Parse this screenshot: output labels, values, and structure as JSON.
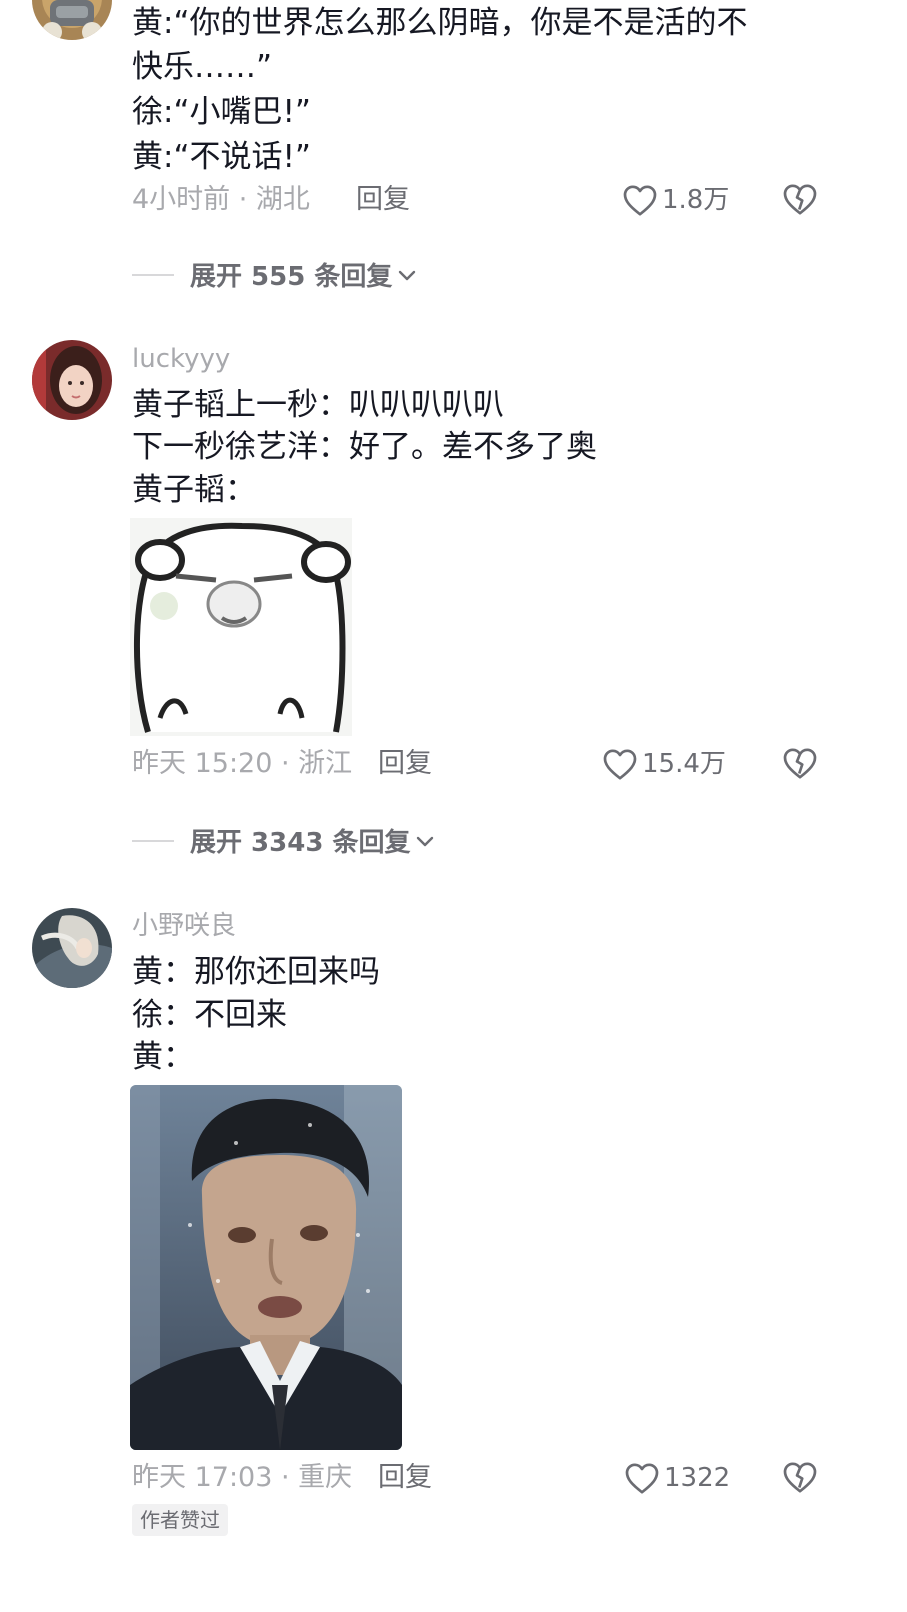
{
  "comments": [
    {
      "lines": [
        "黄:“你的世界怎么那么阴暗，你是不是活的不",
        "快乐……”",
        "徐:“小嘴巴!”",
        "黄:“不说话!”"
      ],
      "time_location": "4小时前 · 湖北",
      "reply_label": "回复",
      "like_count": "1.8万",
      "expand_label": "展开 555 条回复"
    },
    {
      "username": "luckyyy",
      "lines": [
        "黄子韬上一秒：叭叭叭叭叭",
        "下一秒徐艺洋：好了。差不多了奥",
        "黄子韬："
      ],
      "time_location": "昨天 15:20 · 浙江",
      "reply_label": "回复",
      "like_count": "15.4万",
      "expand_label": "展开 3343 条回复"
    },
    {
      "username": "小野咲良",
      "lines": [
        "黄：那你还回来吗",
        "徐：不回来",
        "黄："
      ],
      "time_location": "昨天 17:03 · 重庆",
      "reply_label": "回复",
      "like_count": "1322",
      "badge": "作者赞过"
    }
  ],
  "icons": {
    "like": "heart-outline-icon",
    "dislike": "broken-heart-icon",
    "expand": "chevron-down-icon"
  },
  "colors": {
    "text": "#161823",
    "muted": "#a8a9ad",
    "secondary": "#6b6c72"
  }
}
